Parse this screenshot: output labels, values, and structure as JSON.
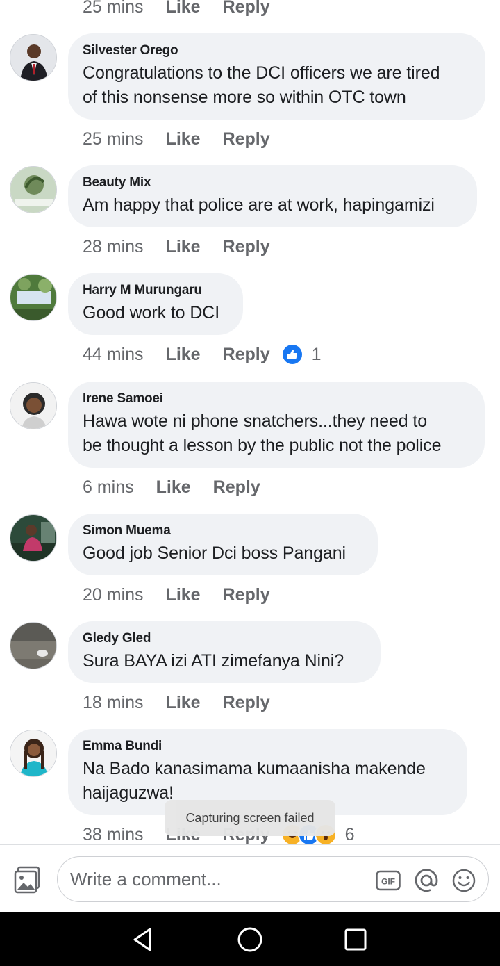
{
  "top_meta": {
    "time": "25 mins",
    "like": "Like",
    "reply": "Reply"
  },
  "comments": [
    {
      "author": "Silvester Orego",
      "text_lines": [
        "Congratulations to the DCI officers we are tired",
        "of this nonsense more so within OTC town"
      ],
      "time": "25 mins",
      "like": "Like",
      "reply": "Reply"
    },
    {
      "author": "Beauty Mix",
      "text_lines": [
        "Am happy that police are at work, hapingamizi"
      ],
      "time": "28 mins",
      "like": "Like",
      "reply": "Reply"
    },
    {
      "author": "Harry M Murungaru",
      "text_lines": [
        "Good work to DCI"
      ],
      "time": "44 mins",
      "like": "Like",
      "reply": "Reply",
      "reaction_count": "1"
    },
    {
      "author": "Irene Samoei",
      "text_lines": [
        "Hawa wote ni phone snatchers...they need to",
        "be thought a lesson by the public not the police"
      ],
      "time": "6 mins",
      "like": "Like",
      "reply": "Reply"
    },
    {
      "author": "Simon Muema",
      "text_lines": [
        "Good job Senior Dci boss Pangani"
      ],
      "time": "20 mins",
      "like": "Like",
      "reply": "Reply"
    },
    {
      "author": "Gledy Gled",
      "text_lines": [
        "Sura BAYA izi ATI zimefanya Nini?"
      ],
      "time": "18 mins",
      "like": "Like",
      "reply": "Reply"
    },
    {
      "author": "Emma Bundi",
      "text_lines": [
        "Na Bado kanasimama kumaanisha makende",
        "haijaguzwa!"
      ],
      "time": "38 mins",
      "like": "Like",
      "reply": "Reply",
      "reaction_count": "6"
    }
  ],
  "toast": "Capturing screen failed",
  "composer": {
    "placeholder": "Write a comment...",
    "gif_label": "GIF"
  },
  "icons": {
    "photo": "photo-icon",
    "gif": "gif-icon",
    "mention": "at-icon",
    "emoji": "emoji-icon",
    "like": "thumbs-up-icon",
    "haha": "haha-icon",
    "wow": "wow-icon",
    "back": "back-icon",
    "home": "home-icon",
    "recents": "recents-icon"
  },
  "colors": {
    "bubble": "#f0f2f5",
    "meta_text": "#65676b",
    "like_blue": "#1877f2",
    "nav_bar": "#000000"
  }
}
